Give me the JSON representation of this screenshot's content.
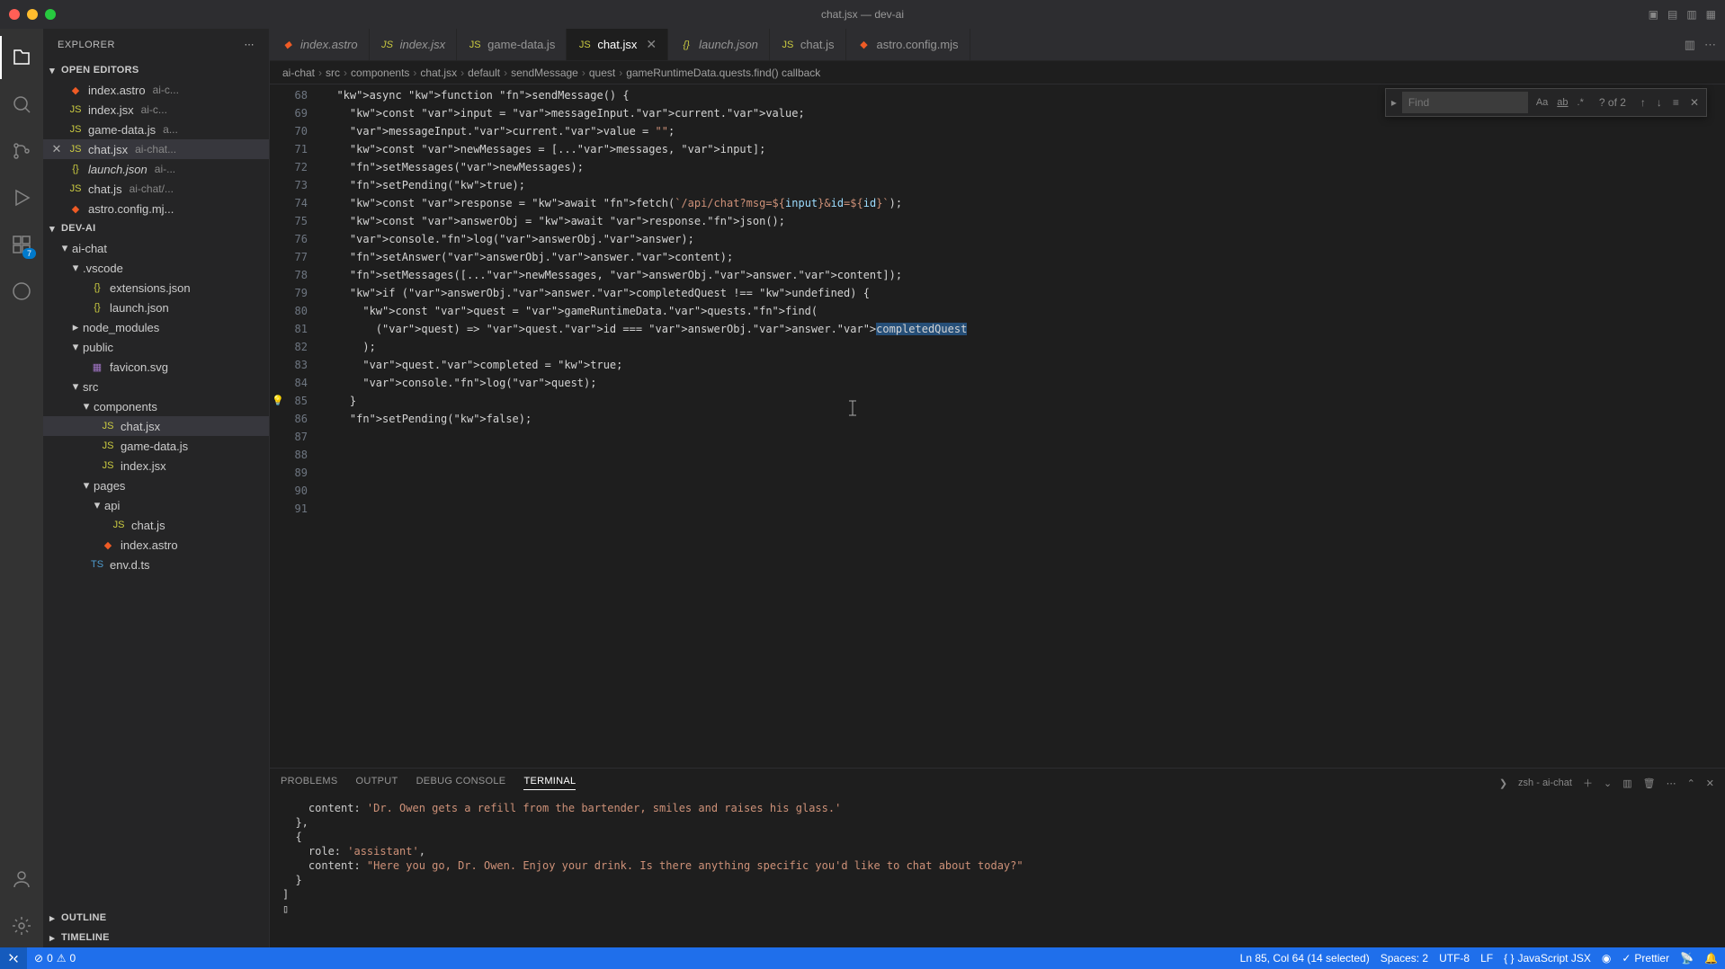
{
  "window": {
    "title": "chat.jsx — dev-ai"
  },
  "activityBar": {
    "extensionsBadge": "7"
  },
  "sidebar": {
    "title": "EXPLORER",
    "sections": {
      "openEditors": {
        "label": "OPEN EDITORS",
        "items": [
          {
            "icon": "astro",
            "name": "index.astro",
            "dim": "ai-c..."
          },
          {
            "icon": "js",
            "name": "index.jsx",
            "dim": "ai-c..."
          },
          {
            "icon": "js",
            "name": "game-data.js",
            "dim": "a..."
          },
          {
            "icon": "js",
            "name": "chat.jsx",
            "dim": "ai-chat...",
            "active": true,
            "close": true
          },
          {
            "icon": "json",
            "name": "launch.json",
            "dim": "ai-...",
            "italic": true
          },
          {
            "icon": "js",
            "name": "chat.js",
            "dim": "ai-chat/..."
          },
          {
            "icon": "astro",
            "name": "astro.config.mj...",
            "dim": ""
          }
        ]
      },
      "project": {
        "label": "DEV-AI",
        "tree": [
          {
            "type": "folder",
            "depth": 1,
            "open": true,
            "name": "ai-chat"
          },
          {
            "type": "folder",
            "depth": 2,
            "open": true,
            "name": ".vscode"
          },
          {
            "type": "file",
            "depth": 3,
            "icon": "json",
            "name": "extensions.json"
          },
          {
            "type": "file",
            "depth": 3,
            "icon": "json",
            "name": "launch.json"
          },
          {
            "type": "folder",
            "depth": 2,
            "open": false,
            "name": "node_modules"
          },
          {
            "type": "folder",
            "depth": 2,
            "open": true,
            "name": "public"
          },
          {
            "type": "file",
            "depth": 3,
            "icon": "svg",
            "name": "favicon.svg"
          },
          {
            "type": "folder",
            "depth": 2,
            "open": true,
            "name": "src"
          },
          {
            "type": "folder",
            "depth": 3,
            "open": true,
            "name": "components"
          },
          {
            "type": "file",
            "depth": 4,
            "icon": "js",
            "name": "chat.jsx",
            "active": true
          },
          {
            "type": "file",
            "depth": 4,
            "icon": "js",
            "name": "game-data.js"
          },
          {
            "type": "file",
            "depth": 4,
            "icon": "js",
            "name": "index.jsx"
          },
          {
            "type": "folder",
            "depth": 3,
            "open": true,
            "name": "pages"
          },
          {
            "type": "folder",
            "depth": 4,
            "open": true,
            "name": "api"
          },
          {
            "type": "file",
            "depth": 5,
            "icon": "js",
            "name": "chat.js"
          },
          {
            "type": "file",
            "depth": 4,
            "icon": "astro",
            "name": "index.astro"
          },
          {
            "type": "file",
            "depth": 3,
            "icon": "ts",
            "name": "env.d.ts"
          }
        ]
      },
      "outline": {
        "label": "OUTLINE"
      },
      "timeline": {
        "label": "TIMELINE"
      }
    }
  },
  "tabs": [
    {
      "icon": "astro",
      "label": "index.astro",
      "italic": true
    },
    {
      "icon": "js",
      "label": "index.jsx",
      "italic": true
    },
    {
      "icon": "js",
      "label": "game-data.js"
    },
    {
      "icon": "js",
      "label": "chat.jsx",
      "active": true,
      "close": true
    },
    {
      "icon": "json",
      "label": "launch.json",
      "italic": true
    },
    {
      "icon": "js",
      "label": "chat.js"
    },
    {
      "icon": "astro",
      "label": "astro.config.mjs"
    }
  ],
  "breadcrumb": [
    "ai-chat",
    "src",
    "components",
    "chat.jsx",
    "default",
    "sendMessage",
    "quest",
    "gameRuntimeData.quests.find() callback"
  ],
  "find": {
    "placeholder": "Find",
    "count": "? of 2"
  },
  "editor": {
    "startLine": 68,
    "lines": [
      "  async function sendMessage() {",
      "    const input = messageInput.current.value;",
      "    messageInput.current.value = \"\";",
      "",
      "    const newMessages = [...messages, input];",
      "    setMessages(newMessages);",
      "    setPending(true);",
      "",
      "    const response = await fetch(`/api/chat?msg=${input}&id=${id}`);",
      "    const answerObj = await response.json();",
      "    console.log(answerObj.answer);",
      "    setAnswer(answerObj.answer.content);",
      "",
      "    setMessages([...newMessages, answerObj.answer.content]);",
      "",
      "    if (answerObj.answer.completedQuest !== undefined) {",
      "      const quest = gameRuntimeData.quests.find(",
      "        (quest) => quest.id === answerObj.answer.completedQuest",
      "      );",
      "      quest.completed = true;",
      "      console.log(quest);",
      "    }",
      "",
      "    setPending(false);"
    ],
    "bulbLine": 85
  },
  "panel": {
    "tabs": [
      "PROBLEMS",
      "OUTPUT",
      "DEBUG CONSOLE",
      "TERMINAL"
    ],
    "activeTab": 3,
    "terminalLabel": "zsh - ai-chat",
    "terminalText": "    content: 'Dr. Owen gets a refill from the bartender, smiles and raises his glass.'\n  },\n  {\n    role: 'assistant',\n    content: \"Here you go, Dr. Owen. Enjoy your drink. Is there anything specific you'd like to chat about today?\"\n  }\n]\n▯"
  },
  "statusbar": {
    "errors": "0",
    "warnings": "0",
    "position": "Ln 85, Col 64 (14 selected)",
    "spaces": "Spaces: 2",
    "encoding": "UTF-8",
    "eol": "LF",
    "lang": "JavaScript JSX",
    "prettier": "Prettier"
  }
}
